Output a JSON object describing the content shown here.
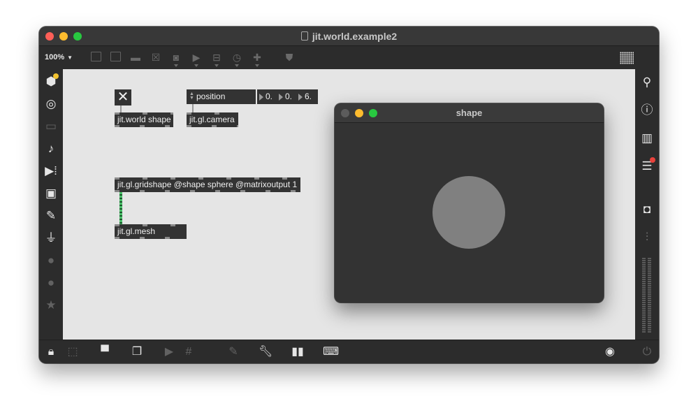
{
  "window": {
    "title": "jit.world.example2"
  },
  "toolbar": {
    "zoom": "100%"
  },
  "patch": {
    "toggle_glyph": "✕",
    "world_object": "jit.world shape",
    "camera_object": "jit.gl.camera",
    "message": "position",
    "numbers": [
      "0.",
      "0.",
      "6."
    ],
    "gridshape_object": "jit.gl.gridshape @shape sphere @matrixoutput 1",
    "mesh_object": "jit.gl.mesh"
  },
  "render_window": {
    "title": "shape"
  },
  "colors": {
    "canvas": "#e5e5e5",
    "object": "#333333",
    "matrix_cord": "#4cc16b",
    "sphere": "#808080"
  }
}
